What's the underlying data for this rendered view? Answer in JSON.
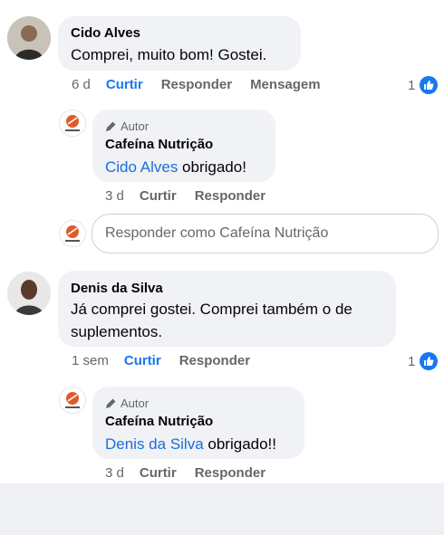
{
  "comments": [
    {
      "author": "Cido Alves",
      "text": "Comprei, muito bom! Gostei.",
      "time": "6 d",
      "like_label": "Curtir",
      "reply_label": "Responder",
      "message_label": "Mensagem",
      "reaction_count": "1",
      "reply": {
        "badge": "Autor",
        "author": "Cafeína Nutrição",
        "mention": "Cido Alves",
        "text": " obrigado!",
        "time": "3 d",
        "like_label": "Curtir",
        "reply_label": "Responder"
      }
    },
    {
      "author": "Denis da Silva",
      "text_line1": "Já comprei gostei. Comprei também o de",
      "text_line2": "suplementos.",
      "time": "1 sem",
      "like_label": "Curtir",
      "reply_label": "Responder",
      "reaction_count": "1",
      "reply": {
        "badge": "Autor",
        "author": "Cafeína Nutrição",
        "mention": "Denis da Silva",
        "text": " obrigado!!",
        "time": "3 d",
        "like_label": "Curtir",
        "reply_label": "Responder"
      }
    }
  ],
  "reply_box": {
    "placeholder": "Responder como Cafeína Nutrição"
  },
  "colors": {
    "accent": "#1877f2",
    "mention": "#1a6ed8",
    "bubble": "#f0f2f5",
    "meta": "#65676b",
    "brand": "#e05a2b"
  }
}
